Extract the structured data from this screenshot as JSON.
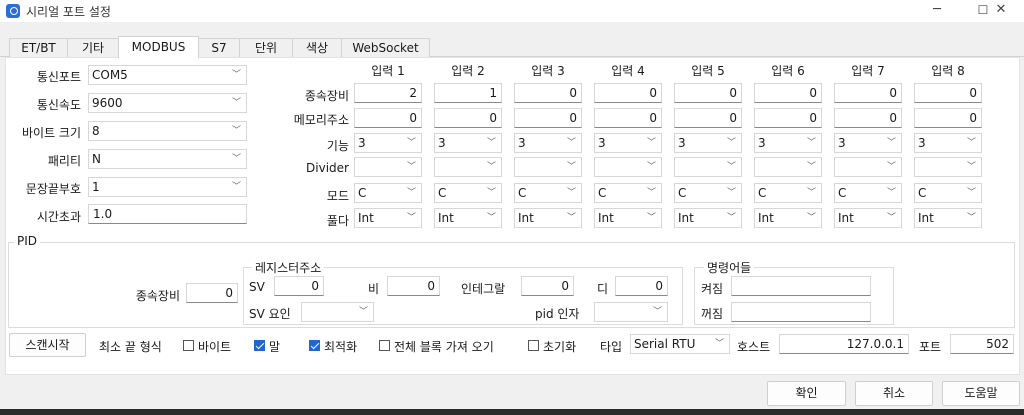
{
  "window": {
    "title": "시리얼 포트 설정",
    "minimize": "─",
    "maximize": "☐",
    "close": "✕"
  },
  "tabs": [
    "ET/BT",
    "기타",
    "MODBUS",
    "S7",
    "단위",
    "색상",
    "WebSocket"
  ],
  "active_tab": "MODBUS",
  "serial": {
    "port_label": "통신포트",
    "port_value": "COM5",
    "baud_label": "통신속도",
    "baud_value": "9600",
    "bytesize_label": "바이트 크기",
    "bytesize_value": "8",
    "parity_label": "패리티",
    "parity_value": "N",
    "stopbits_label": "문장끝부호",
    "stopbits_value": "1",
    "timeout_label": "시간초과",
    "timeout_value": "1.0"
  },
  "inputs": {
    "headers": [
      "입력 1",
      "입력 2",
      "입력 3",
      "입력 4",
      "입력 5",
      "입력 6",
      "입력 7",
      "입력 8"
    ],
    "row_labels": {
      "slave": "종속장비",
      "address": "메모리주소",
      "function": "기능",
      "divider": "Divider",
      "mode": "모드",
      "decode": "풀다"
    },
    "slave": [
      "2",
      "1",
      "0",
      "0",
      "0",
      "0",
      "0",
      "0"
    ],
    "address": [
      "0",
      "0",
      "0",
      "0",
      "0",
      "0",
      "0",
      "0"
    ],
    "function": [
      "3",
      "3",
      "3",
      "3",
      "3",
      "3",
      "3",
      "3"
    ],
    "divider": [
      "",
      "",
      "",
      "",
      "",
      "",
      "",
      ""
    ],
    "mode": [
      "C",
      "C",
      "C",
      "C",
      "C",
      "C",
      "C",
      "C"
    ],
    "decode": [
      "Int",
      "Int",
      "Int",
      "Int",
      "Int",
      "Int",
      "Int",
      "Int"
    ]
  },
  "pid": {
    "group_label": "PID",
    "slave_label": "종속장비",
    "slave_value": "0",
    "register_group": "레지스터주소",
    "sv_label": "SV",
    "sv_value": "0",
    "p_label": "비",
    "p_value": "0",
    "i_label": "인테그랄",
    "i_value": "0",
    "d_label": "디",
    "d_value": "0",
    "sv_factor_label": "SV 요인",
    "sv_factor_value": "",
    "pid_factor_label": "pid 인자",
    "pid_factor_value": "",
    "command_group": "명령어들",
    "on_label": "켜짐",
    "on_value": "",
    "off_label": "꺼짐",
    "off_value": ""
  },
  "bottom": {
    "scan_button": "스캔시작",
    "min_end_label": "최소 끝 형식",
    "byte_label": "바이트",
    "byte_checked": false,
    "word_label": "말",
    "word_checked": true,
    "optimize_label": "최적화",
    "optimize_checked": true,
    "fetch_all_label": "전체 블록 가져 오기",
    "fetch_all_checked": false,
    "init_label": "초기화",
    "init_checked": false,
    "type_label": "타입",
    "type_value": "Serial RTU",
    "host_label": "호스트",
    "host_value": "127.0.0.1",
    "port_label": "포트",
    "port_value": "502"
  },
  "dialog": {
    "ok": "확인",
    "cancel": "취소",
    "help": "도움말"
  },
  "colors": {
    "accent": "#1f67c9",
    "background": "#f0f0f0",
    "panel": "#ffffff"
  }
}
